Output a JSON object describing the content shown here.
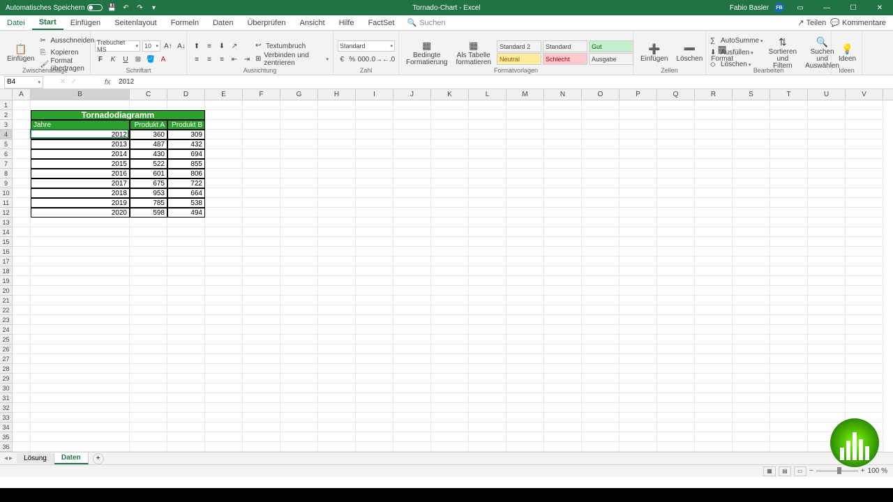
{
  "titlebar": {
    "autosave": "Automatisches Speichern",
    "title": "Tornado-Chart - Excel",
    "username": "Fabio Basler",
    "userInitials": "FB"
  },
  "menu": {
    "file": "Datei",
    "start": "Start",
    "insert": "Einfügen",
    "pagelayout": "Seitenlayout",
    "formulas": "Formeln",
    "data": "Daten",
    "review": "Überprüfen",
    "view": "Ansicht",
    "help": "Hilfe",
    "factset": "FactSet",
    "search": "Suchen",
    "share": "Teilen",
    "comments": "Kommentare"
  },
  "ribbon": {
    "paste": "Einfügen",
    "cut": "Ausschneiden",
    "copy": "Kopieren",
    "formatpainter": "Format übertragen",
    "clipboard": "Zwischenablage",
    "fontname": "Trebuchet MS",
    "fontsize": "10",
    "font": "Schriftart",
    "alignment": "Ausrichtung",
    "wraptext": "Textumbruch",
    "merge": "Verbinden und zentrieren",
    "numberformat": "Standard",
    "number": "Zahl",
    "condformat": "Bedingte Formatierung",
    "astable": "Als Tabelle formatieren",
    "styles": "Formatvorlagen",
    "style_std2": "Standard 2",
    "style_std": "Standard",
    "style_good": "Gut",
    "style_neutral": "Neutral",
    "style_bad": "Schlecht",
    "style_output": "Ausgabe",
    "insertcells": "Einfügen",
    "delete": "Löschen",
    "format": "Format",
    "cells": "Zellen",
    "autosum": "AutoSumme",
    "fill": "Ausfüllen",
    "clear": "Löschen",
    "sortfilter": "Sortieren und Filtern",
    "findselect": "Suchen und Auswählen",
    "editing": "Bearbeiten",
    "ideas": "Ideen"
  },
  "formulabar": {
    "namebox": "B4",
    "formula": "2012"
  },
  "columns": [
    "A",
    "B",
    "C",
    "D",
    "E",
    "F",
    "G",
    "H",
    "I",
    "J",
    "K",
    "L",
    "M",
    "N",
    "O",
    "P",
    "Q",
    "R",
    "S",
    "T",
    "U",
    "V"
  ],
  "colwidths": {
    "A": 26,
    "B": 142,
    "C": 54,
    "D": 54,
    "default": 54
  },
  "selectedCell": {
    "row": 4,
    "col": "B"
  },
  "table": {
    "title": "Tornadodiagramm",
    "headers": [
      "Jahre",
      "Produkt A",
      "Produkt B"
    ],
    "rows": [
      [
        "2012",
        "360",
        "309"
      ],
      [
        "2013",
        "487",
        "432"
      ],
      [
        "2014",
        "430",
        "694"
      ],
      [
        "2015",
        "522",
        "855"
      ],
      [
        "2016",
        "601",
        "806"
      ],
      [
        "2017",
        "675",
        "722"
      ],
      [
        "2018",
        "953",
        "664"
      ],
      [
        "2019",
        "785",
        "538"
      ],
      [
        "2020",
        "598",
        "494"
      ]
    ]
  },
  "sheets": {
    "tab1": "Lösung",
    "tab2": "Daten"
  },
  "statusbar": {
    "zoom": "100 %"
  }
}
